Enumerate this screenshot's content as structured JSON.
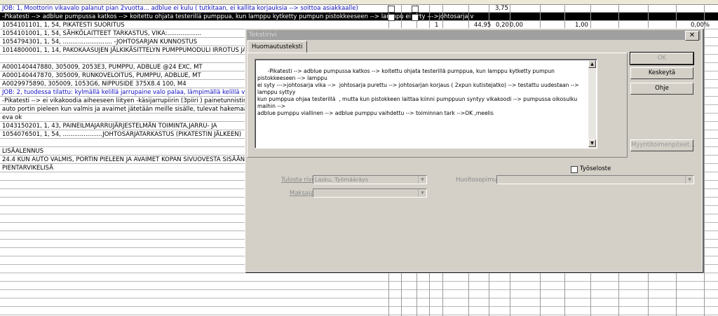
{
  "grid": {
    "rows": [
      {
        "text": "JOB: 1, Moottorin vikavalo palanut pian 2vuotta... adblue ei kulu ( tutkitaan, ei kallita korjauksia --> soittoa asiakkaalle)",
        "style": "blue",
        "value": "3,75"
      },
      {
        "text": "-Pikatesti --> adblue pumpussa katkos --> koitettu ohjata testerillä pumppua, kun lamppu kytketty pumpun pistokkeeseen --> lamppu ei syty --->johtosarja v",
        "style": "sel",
        "value": ""
      },
      {
        "text": "1054101101, 1, 54, PIKATESTI SUORITUS",
        "style": "",
        "value": ""
      },
      {
        "text": "1054101001, 1, 54, SÄHKÖLAITTEET TARKASTUS, VIKA:..................",
        "style": "",
        "value": ""
      },
      {
        "text": "1054794301, 1, 54, .......................... -JOHTOSARJAN KUNNOSTUS",
        "style": "",
        "value": ""
      },
      {
        "text": "1014800001, 1, 14, PAKOKAASUJEN JÄLKIKÄSITTELYN PUMPPUMODULI IRROTUS JA AS",
        "style": "",
        "value": ""
      },
      {
        "text": "",
        "style": "",
        "value": ""
      },
      {
        "text": "A000140447880, 305009, 2053E3, PUMPPU, ADBLUE @24     EXC, MT",
        "style": "",
        "value": ""
      },
      {
        "text": "A000140447870, 305009, RUNKOVELOITUS, PUMPPU, ADBLUE, MT",
        "style": "",
        "value": ""
      },
      {
        "text": "A0029975890, 305009, 1053G6, NIPPUSIDE 375X8.4          100, M4",
        "style": "",
        "value": ""
      },
      {
        "text": "JOB: 2, tuodessa tilattu: kylmällä kelillä jarrupaine valo palaa, lämpimällä kelillä valo ei pala",
        "style": "blue",
        "value": ""
      },
      {
        "text": "-Pikatesti --> ei vikakoodia aiheeseen liityen   -käsijarrupiirin (3piiri ) painetunnistimen tark --> tunni",
        "style": "",
        "value": ""
      },
      {
        "text": "auto portin pieleen kun valmis ja avaimet jätetään meille sisälle, tulevat hakemaan toisilla avaimilla",
        "style": "",
        "value": ""
      },
      {
        "text": "eva ok",
        "style": "",
        "value": ""
      },
      {
        "text": "1043150201, 1, 43, PAINEILMAJARRUJÄRJESTELMÄN TOIMINTA,JARRU- JA",
        "style": "",
        "value": ""
      },
      {
        "text": "1054076501, 1, 54, .....................JOHTOSARJATARKASTUS (PIKATESTIN JÄLKEEN)",
        "style": "",
        "value": ""
      },
      {
        "text": "",
        "style": "",
        "value": ""
      },
      {
        "text": "LISÄALENNUS",
        "style": "",
        "value": ""
      },
      {
        "text": "24.4 KUN AUTO VALMIS, PORTIN PIELEEN JA AVAIMET KOPAN SIVUOVESTA SISÄÄN",
        "style": "",
        "value": ""
      },
      {
        "text": "PIENTARVIKELISÄ",
        "style": "",
        "value": ""
      }
    ],
    "extra_cells": {
      "r3_price": "44,95",
      "r3_disc": "0,20",
      "r3_sum": "0,00",
      "r3_qty2": "1,00",
      "r3_pct": "0,00%",
      "r3_one": "1"
    }
  },
  "dialog": {
    "title": "Tekstirivi",
    "close_glyph": "✕",
    "tab_label": "Huomautusteksti",
    "memo_text": "-Pikatesti --> adblue pumpussa katkos --> koitettu ohjata testerillä pumppua, kun lamppu kytketty pumpun pistokkeeseen --> lamppu\nei syty --->johtosarja vika -->  johtosarja purettu --> johtosarjan korjaus ( 2xpun kutistejatko) --> testattu uudestaan --> lamppu syttyy\nkun pumppua ohjaa testerillä  , mutta kun pistokkeen laittaa kiinni pumppuun syntyy vikakoodi --> pumpussa oikosulku maihin -->\nadblue pumppu viallinen --> adblue pumppu vaihdettu --> toiminnan tark -->OK ,meelis",
    "buttons": {
      "ok": "OK",
      "cancel": "Keskeytä",
      "help": "Ohje",
      "sales": "Myyntitoimenpiteet..."
    },
    "checkbox_label": "Työseloste",
    "print_row_label": "Tulosta rivi",
    "print_row_value": "Lasku, Työmääräys",
    "payer_label": "Maksaja",
    "payer_value": "",
    "service_contract_label": "Huoltosopimus",
    "service_contract_value": ""
  }
}
